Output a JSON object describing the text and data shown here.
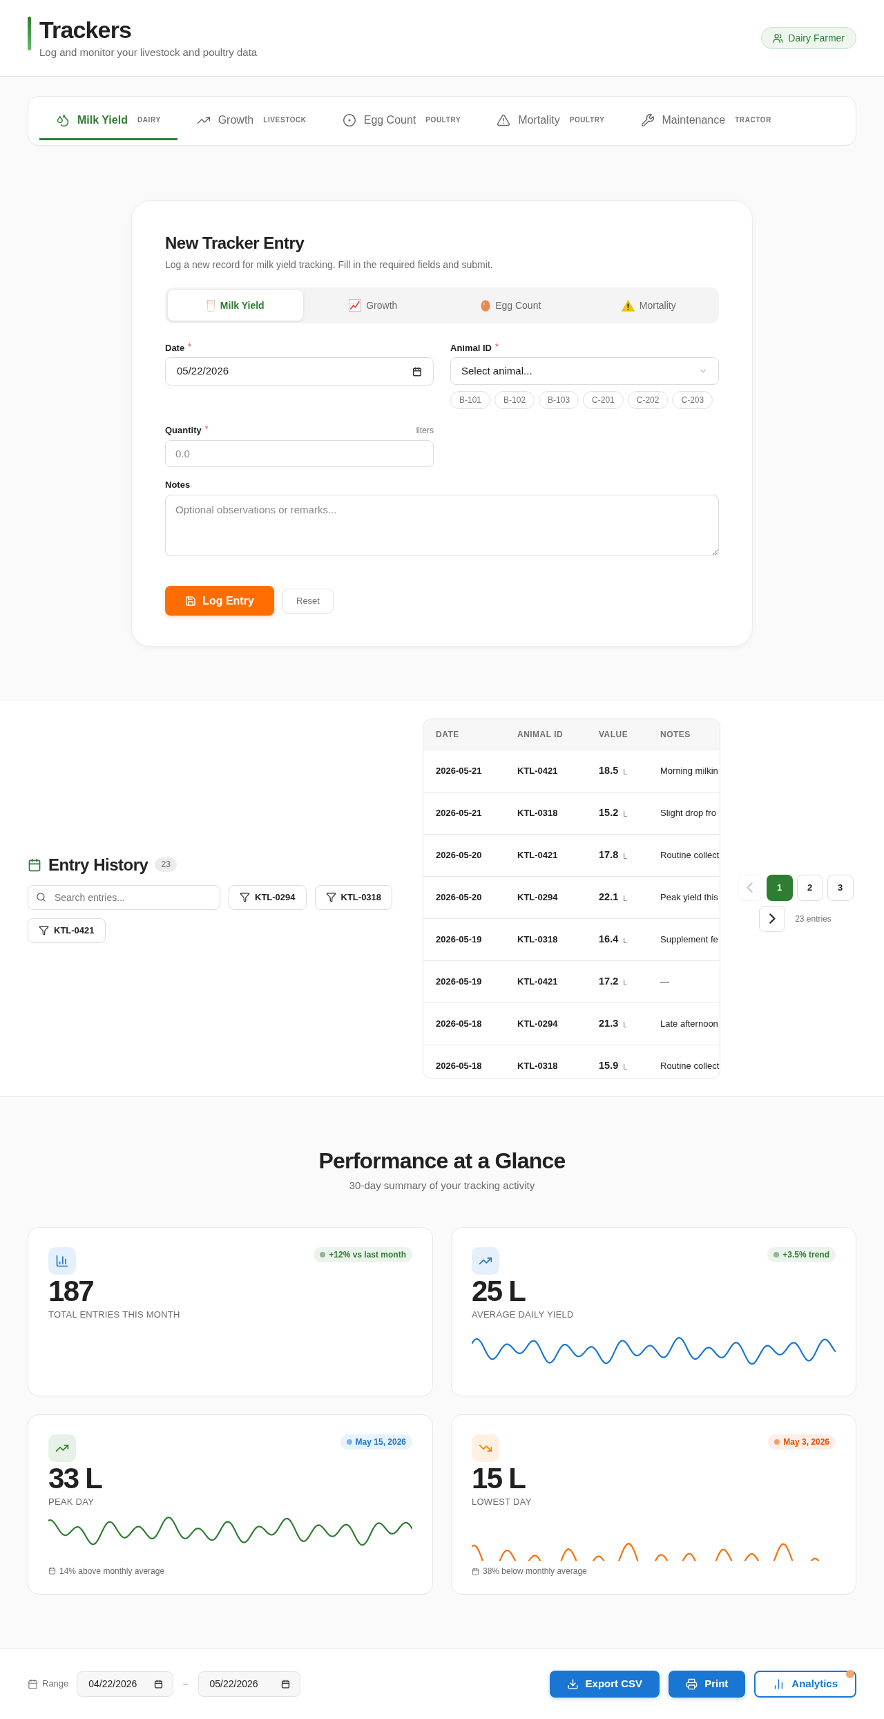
{
  "header": {
    "title": "Trackers",
    "subtitle": "Log and monitor your livestock and poultry data",
    "role": "Dairy Farmer"
  },
  "tracker_tabs": [
    {
      "label": "Milk Yield",
      "category": "DAIRY",
      "selected": true
    },
    {
      "label": "Growth",
      "category": "LIVESTOCK",
      "selected": false
    },
    {
      "label": "Egg Count",
      "category": "POULTRY",
      "selected": false
    },
    {
      "label": "Mortality",
      "category": "POULTRY",
      "selected": false
    },
    {
      "label": "Maintenance",
      "category": "TRACTOR",
      "selected": false
    }
  ],
  "entry_form": {
    "title": "New Tracker Entry",
    "subtitle": "Log a new record for milk yield tracking. Fill in the required fields and submit.",
    "type_tabs": [
      {
        "label": "Milk Yield",
        "selected": true
      },
      {
        "label": "Growth",
        "selected": false
      },
      {
        "label": "Egg Count",
        "selected": false
      },
      {
        "label": "Mortality",
        "selected": false
      }
    ],
    "required_mark": "*",
    "date": {
      "label": "Date",
      "required": true,
      "value": "05/22/2026"
    },
    "animal_id": {
      "label": "Animal ID",
      "required": true,
      "placeholder": "Select animal...",
      "quick_picks": [
        "B-101",
        "B-102",
        "B-103",
        "C-201",
        "C-202",
        "C-203"
      ]
    },
    "quantity": {
      "label": "Quantity",
      "required": true,
      "unit": "liters",
      "placeholder": "0.0"
    },
    "notes": {
      "label": "Notes",
      "required": false,
      "placeholder": "Optional observations or remarks..."
    },
    "submit": "Log Entry",
    "reset": "Reset"
  },
  "entry_history": {
    "title": "Entry History",
    "count": "23",
    "search": {
      "placeholder": "Search entries..."
    },
    "filters": [
      "KTL-0294",
      "KTL-0318",
      "KTL-0421"
    ],
    "table": {
      "columns": [
        "DATE",
        "ANIMAL ID",
        "VALUE",
        "NOTES"
      ],
      "rows": [
        {
          "date": "2026-05-21",
          "animal_id": "KTL-0421",
          "value": "18.5",
          "unit": "L",
          "notes": "Morning milkin"
        },
        {
          "date": "2026-05-21",
          "animal_id": "KTL-0318",
          "value": "15.2",
          "unit": "L",
          "notes": "Slight drop fro"
        },
        {
          "date": "2026-05-20",
          "animal_id": "KTL-0421",
          "value": "17.8",
          "unit": "L",
          "notes": "Routine collect"
        },
        {
          "date": "2026-05-20",
          "animal_id": "KTL-0294",
          "value": "22.1",
          "unit": "L",
          "notes": "Peak yield this"
        },
        {
          "date": "2026-05-19",
          "animal_id": "KTL-0318",
          "value": "16.4",
          "unit": "L",
          "notes": "Supplement fe"
        },
        {
          "date": "2026-05-19",
          "animal_id": "KTL-0421",
          "value": "17.2",
          "unit": "L",
          "notes": "—"
        },
        {
          "date": "2026-05-18",
          "animal_id": "KTL-0294",
          "value": "21.3",
          "unit": "L",
          "notes": "Late afternoon"
        },
        {
          "date": "2026-05-18",
          "animal_id": "KTL-0318",
          "value": "15.9",
          "unit": "L",
          "notes": "Routine collect"
        }
      ]
    },
    "pagination": {
      "previous": {
        "disabled": true
      },
      "pages": [
        {
          "label": "1",
          "selected": true
        },
        {
          "label": "2",
          "selected": false
        },
        {
          "label": "3",
          "selected": false
        }
      ],
      "next": {
        "disabled": false
      },
      "summary": "23 entries"
    }
  },
  "performance": {
    "title": "Performance at a Glance",
    "subtitle": "30-day summary of your tracking activity",
    "cards": [
      {
        "value": "187",
        "label": "TOTAL ENTRIES THIS MONTH",
        "icon": {
          "color": "#1976d2"
        },
        "badge": {
          "text": "+12% vs last month",
          "color": "#2e7d32"
        }
      },
      {
        "value": "25 L",
        "label": "AVERAGE DAILY YIELD",
        "icon": {
          "color": "#1976d2"
        },
        "badge": {
          "text": "+3.5% trend",
          "color": "#2e7d32"
        },
        "sparkline": {
          "color": "#1976d2"
        }
      },
      {
        "value": "33 L",
        "label": "PEAK DAY",
        "icon": {
          "color": "#2e7d32"
        },
        "badge": {
          "text": "May 15, 2026",
          "color": "#1976d2"
        },
        "sparkline": {
          "color": "#2e7d32"
        },
        "footnote": "14% above monthly average"
      },
      {
        "value": "15 L",
        "label": "LOWEST DAY",
        "icon": {
          "color": "#f57c00"
        },
        "badge": {
          "text": "May 3, 2026",
          "color": "#e65100"
        },
        "sparkline": {
          "color": "#ff6d00"
        },
        "footnote": "38% below monthly average"
      }
    ]
  },
  "footer": {
    "range_label": "Range",
    "from": "04/22/2026",
    "separator": "–",
    "to": "05/22/2026",
    "actions": [
      {
        "label": "Export CSV",
        "kind": "primary",
        "notification": false
      },
      {
        "label": "Print",
        "kind": "primary",
        "notification": false
      },
      {
        "label": "Analytics",
        "kind": "outline",
        "notification": true
      }
    ]
  }
}
